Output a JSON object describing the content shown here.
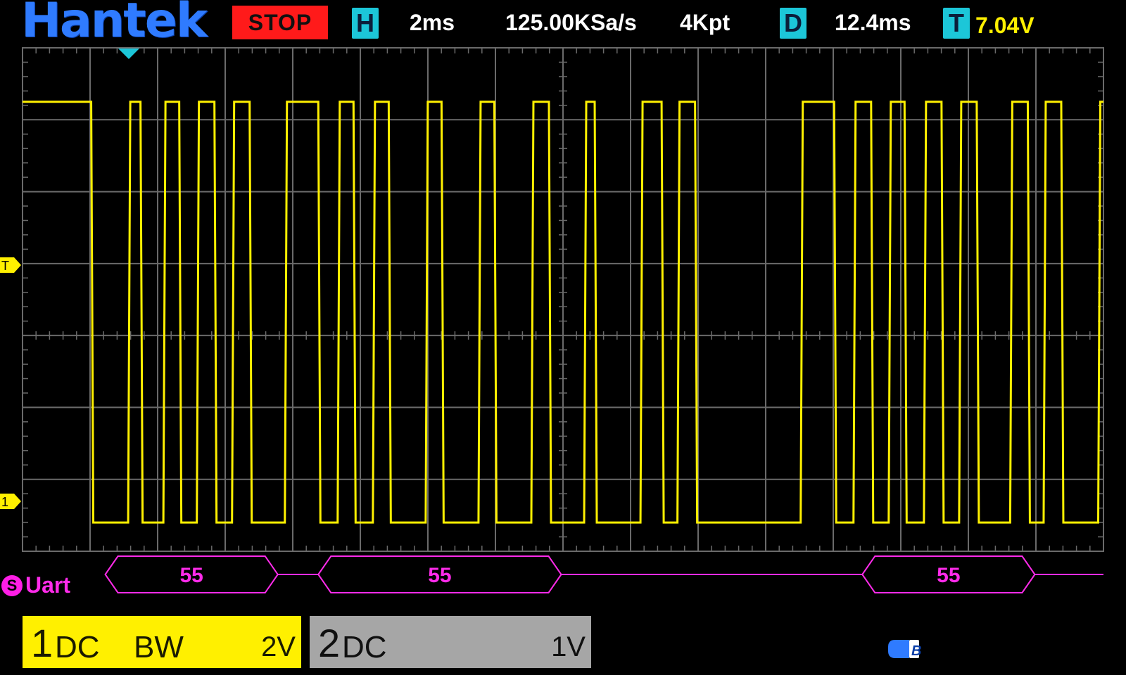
{
  "brand": "Hantek",
  "run_state": "STOP",
  "horizontal": {
    "tag": "H",
    "timebase": "2ms",
    "sample_rate": "125.00KSa/s",
    "memory_depth": "4Kpt"
  },
  "delay": {
    "tag": "D",
    "value": "12.4ms"
  },
  "trigger": {
    "tag": "T",
    "level": "7.04V"
  },
  "markers": {
    "trigger_level": "T",
    "channel1_ground": "1"
  },
  "decode": {
    "badge": "S",
    "protocol": "Uart",
    "frames": [
      {
        "value": "55",
        "start_ms": 2.35,
        "end_ms": 7.25
      },
      {
        "value": "55",
        "start_ms": 8.4,
        "end_ms": 15.3
      },
      {
        "value": "55",
        "start_ms": 23.85,
        "end_ms": 28.75
      }
    ]
  },
  "channels": [
    {
      "number": "1",
      "coupling": "DC",
      "bandwidth_limit": "BW",
      "scale": "2V",
      "color": "#fff000"
    },
    {
      "number": "2",
      "coupling": "DC",
      "scale": "1V",
      "color": "#a6a6a6"
    }
  ],
  "colors": {
    "trace": "#fff000",
    "decode": "#ff2bea",
    "accent": "#1cc6d8",
    "stop": "#ff1a1a",
    "grid": "#6a6a6a"
  },
  "waveform": {
    "unit": "ms",
    "screen_span_ms": [
      0,
      30.7
    ],
    "high_level_div": 3.25,
    "low_level_div": -2.6,
    "edges_ms": [
      1.95,
      3.0,
      3.35,
      4.0,
      4.45,
      4.95,
      5.45,
      5.95,
      6.45,
      7.45,
      8.4,
      8.95,
      9.4,
      9.95,
      10.4,
      11.45,
      11.9,
      12.95,
      13.4,
      14.45,
      14.95,
      15.95,
      16.25,
      17.55,
      18.15,
      18.6,
      19.1,
      22.1,
      23.05,
      23.6,
      24.1,
      24.6,
      25.05,
      25.6,
      26.1,
      26.6,
      27.1,
      28.05,
      28.55,
      29.0,
      29.5,
      30.55
    ]
  }
}
